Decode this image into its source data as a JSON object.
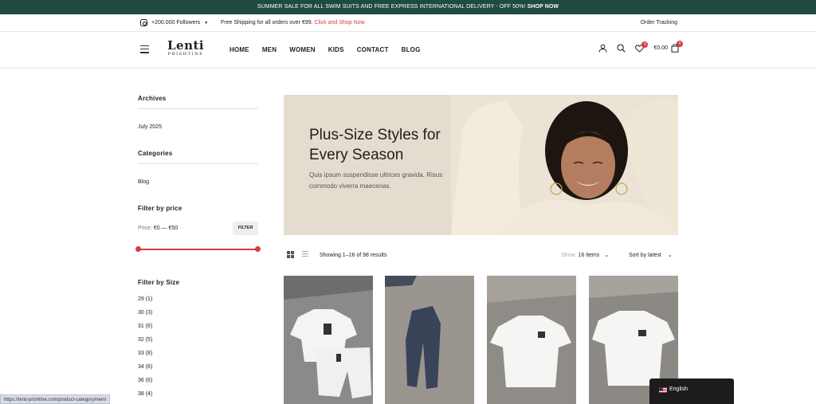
{
  "announcement": {
    "text": "SUMMER SALE FOR ALL SWIM SUITS AND FREE EXPRESS INTERNATIONAL DELIVERY - OFF 50%! ",
    "cta": "SHOP NOW"
  },
  "subbar": {
    "followers": "+200.000 Followers",
    "shipping_text": "Free Shipping for all orders over €99. ",
    "shipping_link": "Click and Shop Now.",
    "order_tracking": "Order Tracking"
  },
  "header": {
    "logo_main": "Lenti",
    "logo_sub": "PRISHTINE",
    "nav": [
      "HOME",
      "MEN",
      "WOMEN",
      "KIDS",
      "CONTACT",
      "BLOG"
    ],
    "wishlist_count": "0",
    "cart_total": "€0.00",
    "cart_count": "0"
  },
  "sidebar": {
    "archives_title": "Archives",
    "archive_item": "July 2025",
    "categories_title": "Categories",
    "category_item": "Blog",
    "price_title": "Filter by price",
    "price_label": "Price: ",
    "price_range": "€0 — €50",
    "filter_button": "FILTER",
    "size_title": "Filter by Size",
    "sizes": [
      "29 (1)",
      "30 (3)",
      "31 (6)",
      "32 (5)",
      "33 (8)",
      "34 (6)",
      "36 (6)",
      "38 (4)"
    ]
  },
  "banner": {
    "title_line1": "Plus-Size Styles for",
    "title_line2": "Every Season",
    "subtitle": "Quis ipsum suspendisse ultrices gravida. Risus commodo viverra maecenas."
  },
  "toolbar": {
    "result_count": "Showing 1–16 of 98 results",
    "show_label": "Show:",
    "show_value": "16 Items",
    "sort_value": "Sort by latest"
  },
  "statusbar_url": "https://lenti-prishtine.com/product-category/men/",
  "language": "English",
  "colors": {
    "brand_green": "#1f4a3f",
    "accent_red": "#d43e3e"
  }
}
